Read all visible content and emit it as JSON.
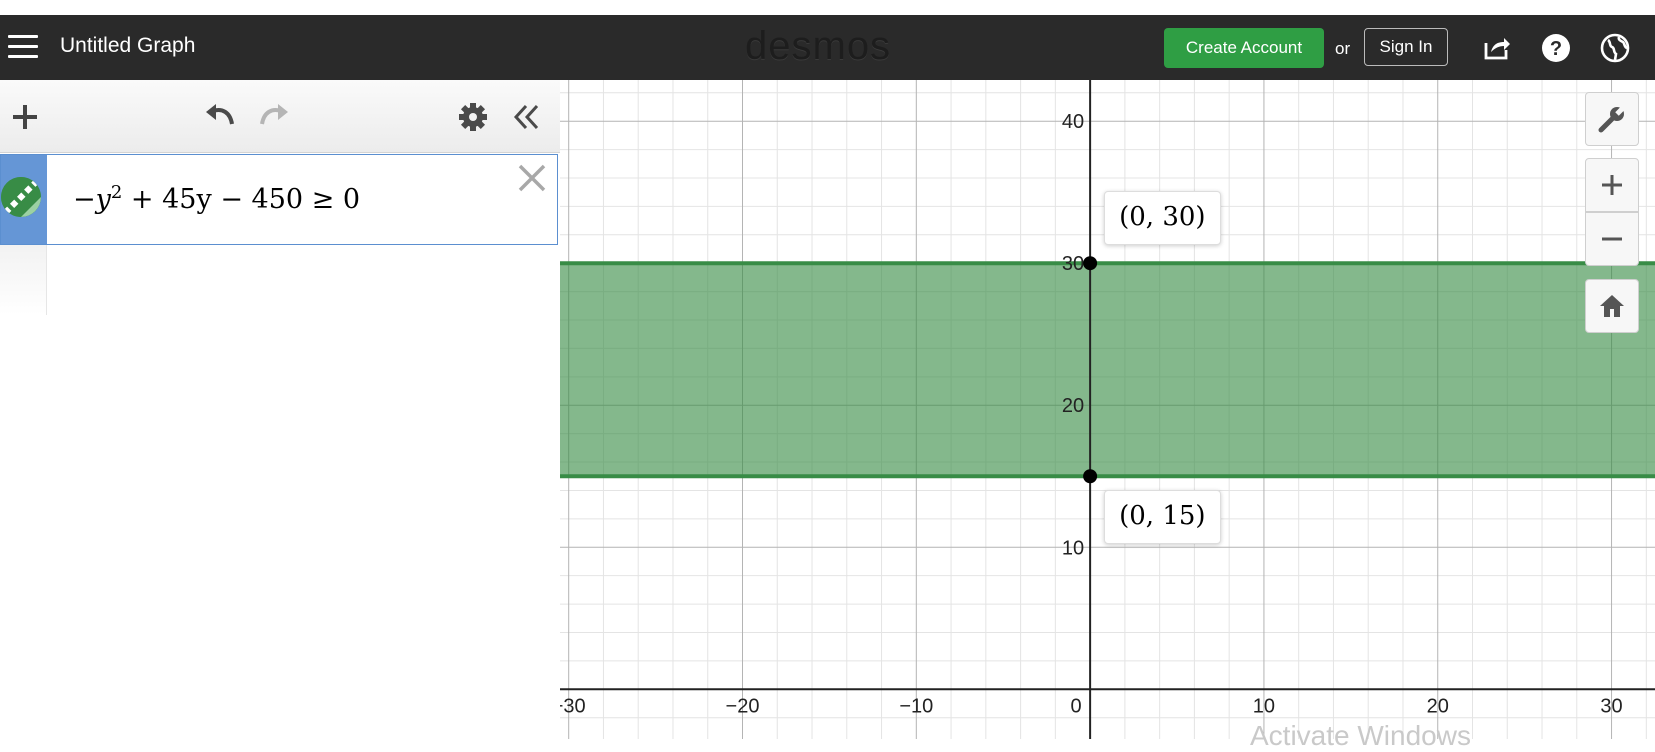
{
  "header": {
    "title": "Untitled Graph",
    "logo": "desmos",
    "create_account_label": "Create Account",
    "or_label": "or",
    "sign_in_label": "Sign In",
    "icons": [
      "share-icon",
      "help-icon",
      "language-globe-icon"
    ]
  },
  "sidebar": {
    "toolbar_icons": [
      "add-icon",
      "undo-icon",
      "redo-icon",
      "settings-gear-icon",
      "collapse-chevrons-icon"
    ],
    "expressions": [
      {
        "latex_parts": {
          "lead": "−y",
          "exp": "2",
          "rest": " + 45y − 450 ≥ 0"
        },
        "color": "#388c46"
      }
    ]
  },
  "graph": {
    "x_range": [
      -30.5,
      32.5
    ],
    "y_range": [
      -3.5,
      42.9
    ],
    "x_ticks": [
      -30,
      -20,
      -10,
      10,
      20,
      30
    ],
    "y_ticks": [
      10,
      20,
      30,
      40
    ],
    "origin_label": "0",
    "region": {
      "y_min": 15,
      "y_max": 30,
      "color": "#388c46"
    },
    "points": [
      {
        "x": 0,
        "y": 30,
        "label": "(0, 30)"
      },
      {
        "x": 0,
        "y": 15,
        "label": "(0, 15)"
      }
    ],
    "controls": [
      "wrench-icon",
      "zoom-in-icon",
      "zoom-out-icon",
      "home-icon"
    ]
  },
  "watermark": "Activate Windows"
}
